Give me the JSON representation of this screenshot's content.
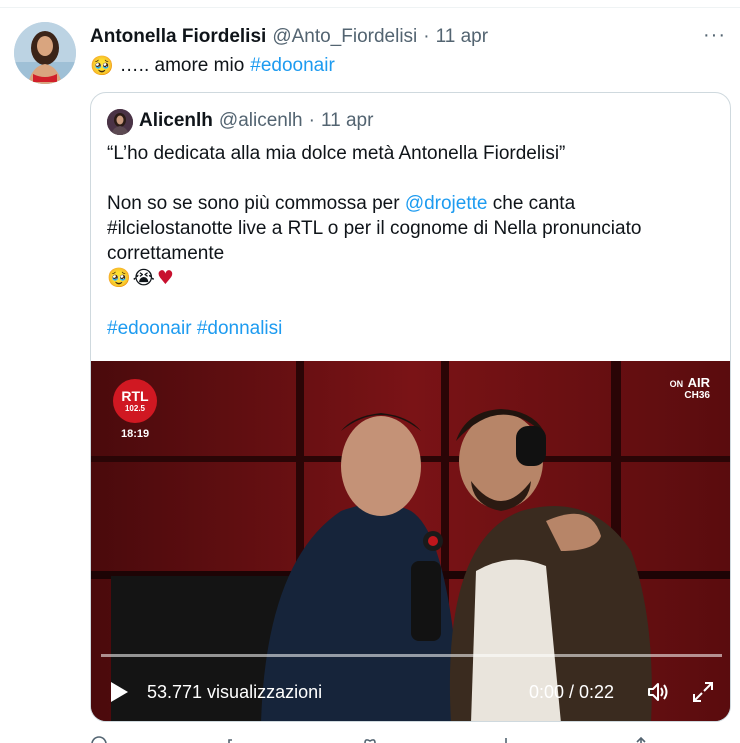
{
  "tweet": {
    "author_name": "Antonella Fiordelisi",
    "author_handle": "@Anto_Fiordelisi",
    "separator": "·",
    "time": "11 apr",
    "more_label": "···",
    "emoji": "🥹",
    "text": "….. amore mio",
    "hashtag": "#edoonair"
  },
  "quoted": {
    "author_name": "Alicenlh",
    "author_handle": "@alicenlh",
    "separator": "·",
    "time": "11 apr",
    "lines": [
      "“L’ho dedicata alla mia dolce metà Antonella Fiordelisi”",
      "",
      "Non so se sono più commossa per @drojette che canta",
      "#ilcielostanotte live a RTL o per il cognome di Nella pronunciato",
      "correttamente"
    ],
    "emojis": [
      "🥹",
      "😭"
    ],
    "heart": "♥",
    "hashtags": "#edoonair #donnalisi"
  },
  "video": {
    "logo_text": "RTL",
    "logo_freq": "102.5",
    "clock": "18:19",
    "onair_on": "ON",
    "onair_air": "AIR",
    "onair_channel": "CH36",
    "views": "53.771 visualizzazioni",
    "timecode": "0:00 / 0:22"
  },
  "colors": {
    "link": "#1d9bf0",
    "muted": "#536471",
    "border": "#cfd9de",
    "heart": "#c8102e"
  }
}
